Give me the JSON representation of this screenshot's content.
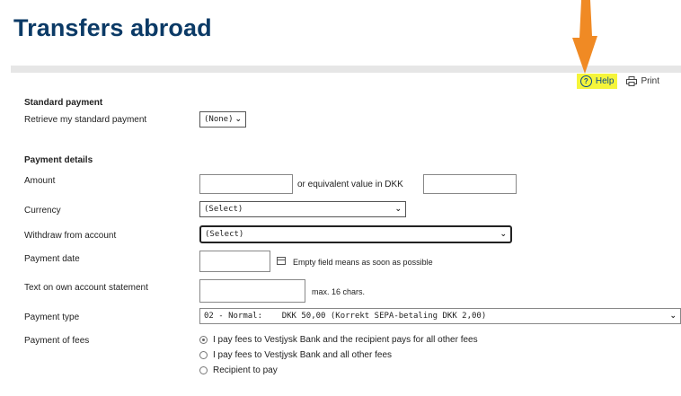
{
  "page": {
    "title": "Transfers abroad"
  },
  "toolbar": {
    "help_label": "Help",
    "print_label": "Print"
  },
  "standard_payment": {
    "section_label": "Standard payment",
    "retrieve_label": "Retrieve my standard payment",
    "retrieve_value": "(None)"
  },
  "payment_details": {
    "section_label": "Payment details",
    "amount_label": "Amount",
    "amount_value": "",
    "equivalent_label": "or equivalent value in DKK",
    "equivalent_value": "",
    "currency_label": "Currency",
    "currency_value": "(Select)",
    "withdraw_label": "Withdraw from account",
    "withdraw_value": "(Select)",
    "date_label": "Payment date",
    "date_value": "",
    "date_hint": "Empty field means as soon as possible",
    "text_label": "Text on own account statement",
    "text_value": "",
    "text_hint": "max. 16 chars.",
    "type_label": "Payment type",
    "type_value": "02 - Normal:    DKK 50,00 (Korrekt SEPA-betaling DKK 2,00)",
    "fees_label": "Payment of fees",
    "fees_options": [
      {
        "label": "I pay fees to Vestjysk Bank and the recipient pays for all other fees",
        "selected": true
      },
      {
        "label": "I pay fees to Vestjysk Bank and all other fees",
        "selected": false
      },
      {
        "label": "Recipient to pay",
        "selected": false
      }
    ]
  },
  "colors": {
    "title": "#0b3a66",
    "highlight": "#f5f53a",
    "arrow": "#f08a24"
  },
  "icons": [
    "help-icon",
    "print-icon",
    "calendar-icon",
    "chevron-down-icon",
    "arrow-annotation-icon"
  ]
}
